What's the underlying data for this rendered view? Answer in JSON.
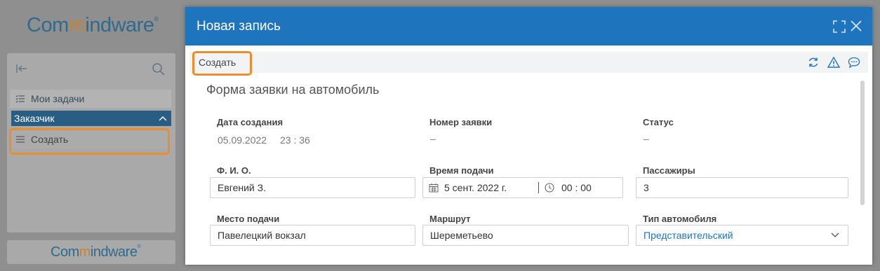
{
  "background": {
    "logo": {
      "part1": "Com",
      "part2": "ind",
      "part3": "ware",
      "mark": "®"
    },
    "nav": {
      "items": [
        {
          "label": "Мои задачи",
          "icon": "task-list-icon"
        },
        {
          "label": "Заказчик",
          "icon": "chevron-up-icon"
        },
        {
          "label": "Создать",
          "icon": "list-icon"
        }
      ]
    },
    "bottom_logo": {
      "part1": "Com",
      "part2": "ind",
      "part3": "ware",
      "mark": "®"
    }
  },
  "dialog": {
    "title": "Новая запись",
    "toolbar": {
      "create_label": "Создать"
    },
    "form_title": "Форма заявки на автомобиль",
    "fields": {
      "created_date": {
        "label": "Дата создания",
        "date": "05.09.2022",
        "time": "23 : 36"
      },
      "request_number": {
        "label": "Номер заявки",
        "value": "–"
      },
      "status": {
        "label": "Статус",
        "value": "–"
      },
      "full_name": {
        "label": "Ф. И. О.",
        "value": "Евгений З."
      },
      "pickup_time": {
        "label": "Время подачи",
        "date": "5 сент. 2022 г.",
        "time": "00 : 00"
      },
      "passengers": {
        "label": "Пассажиры",
        "value": "3"
      },
      "pickup_place": {
        "label": "Место подачи",
        "value": "Павелецкий вокзал"
      },
      "route": {
        "label": "Маршрут",
        "value": "Шереметьево"
      },
      "car_type": {
        "label": "Тип автомобиля",
        "value": "Представительский"
      }
    }
  },
  "colors": {
    "header": "#1f74be",
    "highlight": "#e98e2e",
    "nav_group": "#2a5d83"
  }
}
